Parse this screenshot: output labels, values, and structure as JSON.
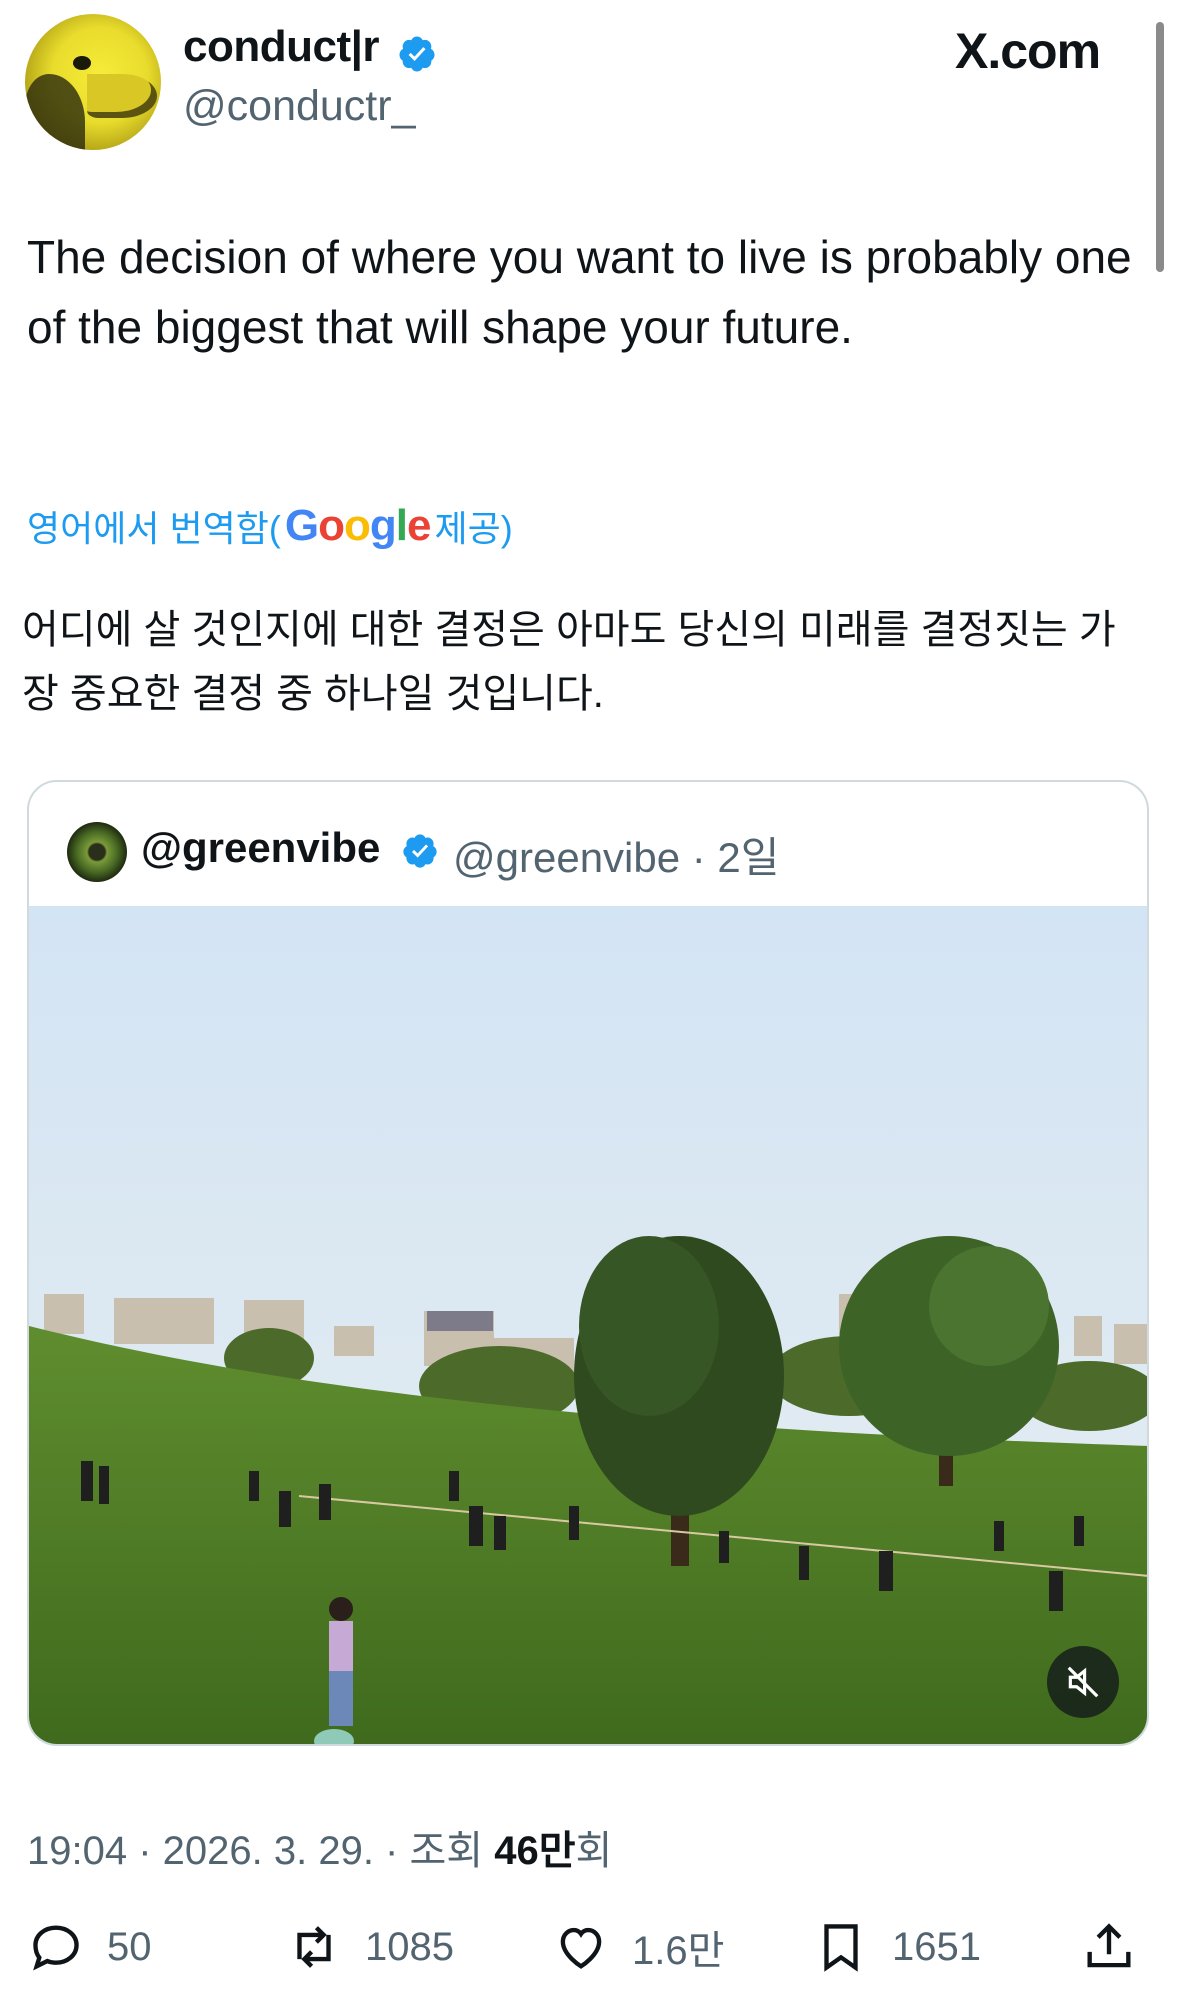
{
  "author": {
    "display_name": "conduct|r",
    "handle": "@conductr_",
    "verified": true
  },
  "site_label": "X.com",
  "tweet": {
    "text": "The decision of where you want to live is probably one of the biggest that will shape your future.",
    "translate_prefix": "영어에서 번역함(",
    "translate_provider": "Google",
    "translate_suffix": " 제공)",
    "translated_text": "어디에 살 것인지에 대한 결정은 아마도 당신의 미래를 결정짓는 가장 중요한 결정 중 하나일 것입니다."
  },
  "quoted": {
    "display_name": "@greenvibe",
    "handle_time": "@greenvibe · 2일",
    "verified": true
  },
  "meta": {
    "time_date": "19:04 · 2026. 3. 29. · 조회 ",
    "views": "46만",
    "views_suffix": "회"
  },
  "actions": {
    "replies": "50",
    "reposts": "1085",
    "likes": "1.6만",
    "bookmarks": "1651"
  },
  "colors": {
    "accent": "#1d9bf0",
    "text": "#0f1419",
    "secondary": "#536471",
    "border": "#cfd9de"
  },
  "icons": [
    "verified-badge-icon",
    "reply-icon",
    "repost-icon",
    "like-icon",
    "bookmark-icon",
    "share-icon",
    "mute-icon"
  ]
}
